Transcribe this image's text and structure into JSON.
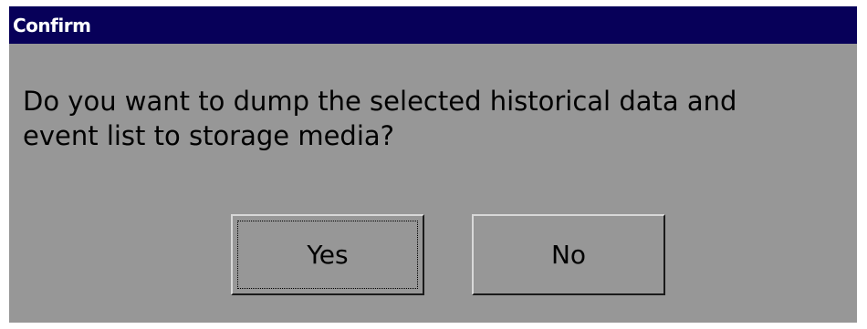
{
  "dialog": {
    "title": "Confirm",
    "message": "Do you want to dump the selected historical data and\nevent list to storage media?",
    "buttons": {
      "yes_label": "Yes",
      "no_label": "No"
    },
    "focused_button": "Yes"
  },
  "colors": {
    "titlebar": "#070059",
    "dialog_background": "#979797",
    "title_text": "#ffffff",
    "body_text": "#000000"
  }
}
